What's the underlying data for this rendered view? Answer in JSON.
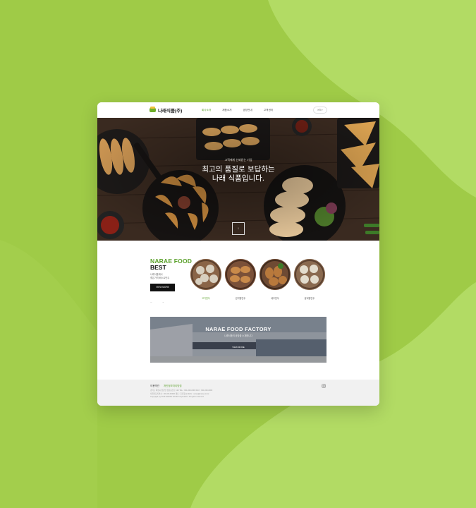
{
  "background": {
    "base": "#9fcb47",
    "blob_light": "#b2db64",
    "blob_dark": "#8cbf3a"
  },
  "header": {
    "logo_text": "나래식품(주)",
    "nav": [
      "회사소개",
      "제품소개",
      "공장안내",
      "고객센터"
    ],
    "active_nav": 0,
    "lang": "KR ▾"
  },
  "hero": {
    "subtitle": "고객에게 신뢰받는 기업",
    "title_line1": "최고의 품질로 보답하는",
    "title_line2": "나래 식품입니다.",
    "scroll_icon": "↓"
  },
  "best": {
    "title1": "NARAE FOOD",
    "title2": "BEST",
    "desc_line1": "나래식품에서",
    "desc_line2": "좋은가격 베스트만두",
    "button": "VIEW MORE",
    "arrows": "← →",
    "products": [
      "고기만두",
      "김치왕만두",
      "새우만두",
      "갈비왕만두"
    ]
  },
  "factory": {
    "title": "NARAE FOOD FACTORY",
    "subtitle": "나래식품의 공장을 소개합니다",
    "button": "VIEW MORE"
  },
  "footer": {
    "link1": "이용약관",
    "link2": "개인정보처리방침",
    "info1": "경기도 화성시 양감면 정문송산로 123   TEL : 031-000-0000   FAX : 031-000-0000",
    "info2": "사업자등록번호 : 000-00-00000  대표 : 홍길동  E-MAIL : narae@narae.co.kr",
    "copyright": "Copyright (c) 2019 NARAE FOOD Corporation. All rights reserved.",
    "insta_icon": "instagram-icon"
  }
}
